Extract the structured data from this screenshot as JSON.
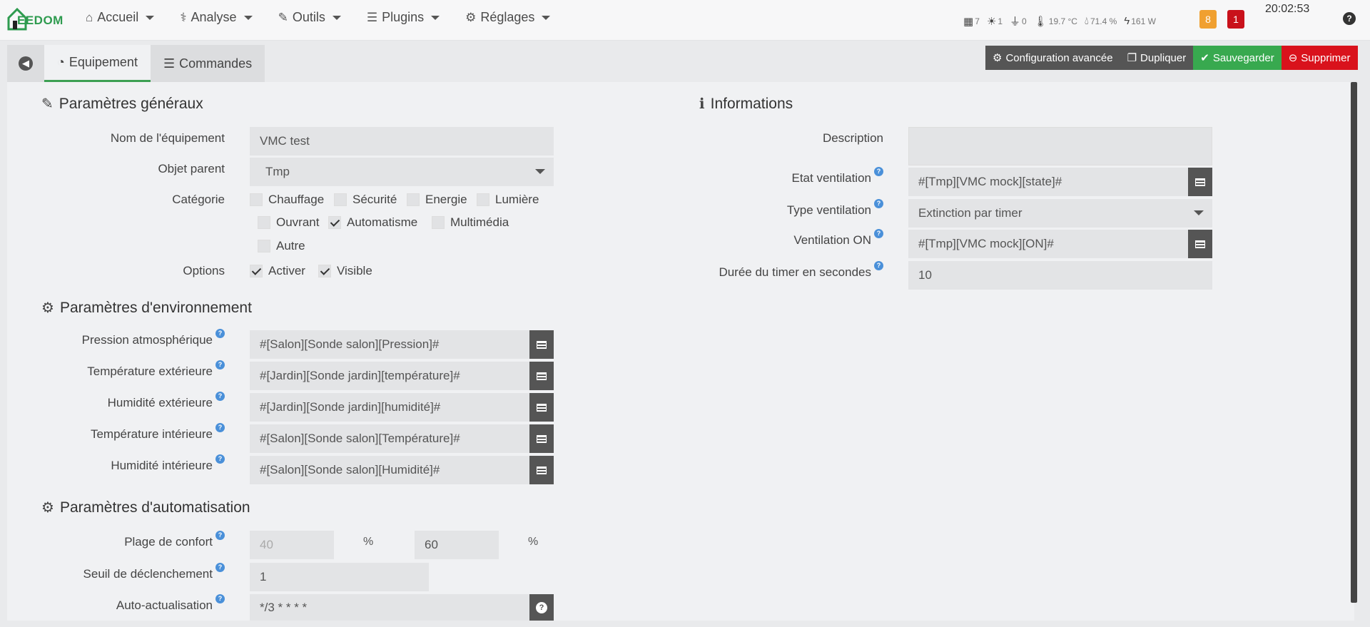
{
  "navbar": {
    "logo_text": "EEDOM",
    "menu": [
      {
        "label": "Accueil",
        "icon": "home-icon"
      },
      {
        "label": "Analyse",
        "icon": "stethoscope-icon"
      },
      {
        "label": "Outils",
        "icon": "wrench-icon"
      },
      {
        "label": "Plugins",
        "icon": "tasks-icon"
      },
      {
        "label": "Réglages",
        "icon": "gear-icon"
      }
    ],
    "status": {
      "shutters": "7",
      "lights": "1",
      "plugs": "0",
      "temperature": "19.7 °C",
      "humidity": "71.4 %",
      "power": "161 W"
    },
    "badge_warning": "8",
    "badge_alert": "1",
    "time": "20:02:53",
    "help": "?"
  },
  "tabs": {
    "equipment": "Equipement",
    "commands": "Commandes"
  },
  "actions": {
    "advanced": "Configuration avancée",
    "duplicate": "Dupliquer",
    "save": "Sauvegarder",
    "delete": "Supprimer"
  },
  "general": {
    "title": "Paramètres généraux",
    "name_label": "Nom de l'équipement",
    "name_value": "VMC test",
    "parent_label": "Objet parent",
    "parent_value": "Tmp",
    "category_label": "Catégorie",
    "categories": [
      {
        "label": "Chauffage",
        "checked": false
      },
      {
        "label": "Sécurité",
        "checked": false
      },
      {
        "label": "Energie",
        "checked": false
      },
      {
        "label": "Lumière",
        "checked": false
      },
      {
        "label": "Ouvrant",
        "checked": false
      },
      {
        "label": "Automatisme",
        "checked": true
      },
      {
        "label": "Multimédia",
        "checked": false
      },
      {
        "label": "Autre",
        "checked": false
      }
    ],
    "options_label": "Options",
    "options": [
      {
        "label": "Activer",
        "checked": true
      },
      {
        "label": "Visible",
        "checked": true
      }
    ]
  },
  "environment": {
    "title": "Paramètres d'environnement",
    "fields": [
      {
        "label": "Pression atmosphérique",
        "value": "#[Salon][Sonde salon][Pression]#"
      },
      {
        "label": "Température extérieure",
        "value": "#[Jardin][Sonde jardin][température]#"
      },
      {
        "label": "Humidité extérieure",
        "value": "#[Jardin][Sonde jardin][humidité]#"
      },
      {
        "label": "Température intérieure",
        "value": "#[Salon][Sonde salon][Température]#"
      },
      {
        "label": "Humidité intérieure",
        "value": "#[Salon][Sonde salon][Humidité]#"
      }
    ]
  },
  "automation": {
    "title": "Paramètres d'automatisation",
    "comfort_label": "Plage de confort",
    "comfort_min": "40",
    "comfort_max": "60",
    "unit": "%",
    "threshold_label": "Seuil de déclenchement",
    "threshold_value": "1",
    "refresh_label": "Auto-actualisation",
    "refresh_value": "*/3 * * * *"
  },
  "info": {
    "title": "Informations",
    "description_label": "Description",
    "description_value": "",
    "state_label": "Etat ventilation",
    "state_value": "#[Tmp][VMC mock][state]#",
    "type_label": "Type ventilation",
    "type_value": "Extinction par timer",
    "on_label": "Ventilation ON",
    "on_value": "#[Tmp][VMC mock][ON]#",
    "timer_label": "Durée du timer en secondes",
    "timer_value": "10"
  },
  "colors": {
    "accent_green": "#38a94f",
    "danger_red": "#d9121c",
    "warning_orange": "#f0a030",
    "help_blue": "#4a90d9"
  }
}
